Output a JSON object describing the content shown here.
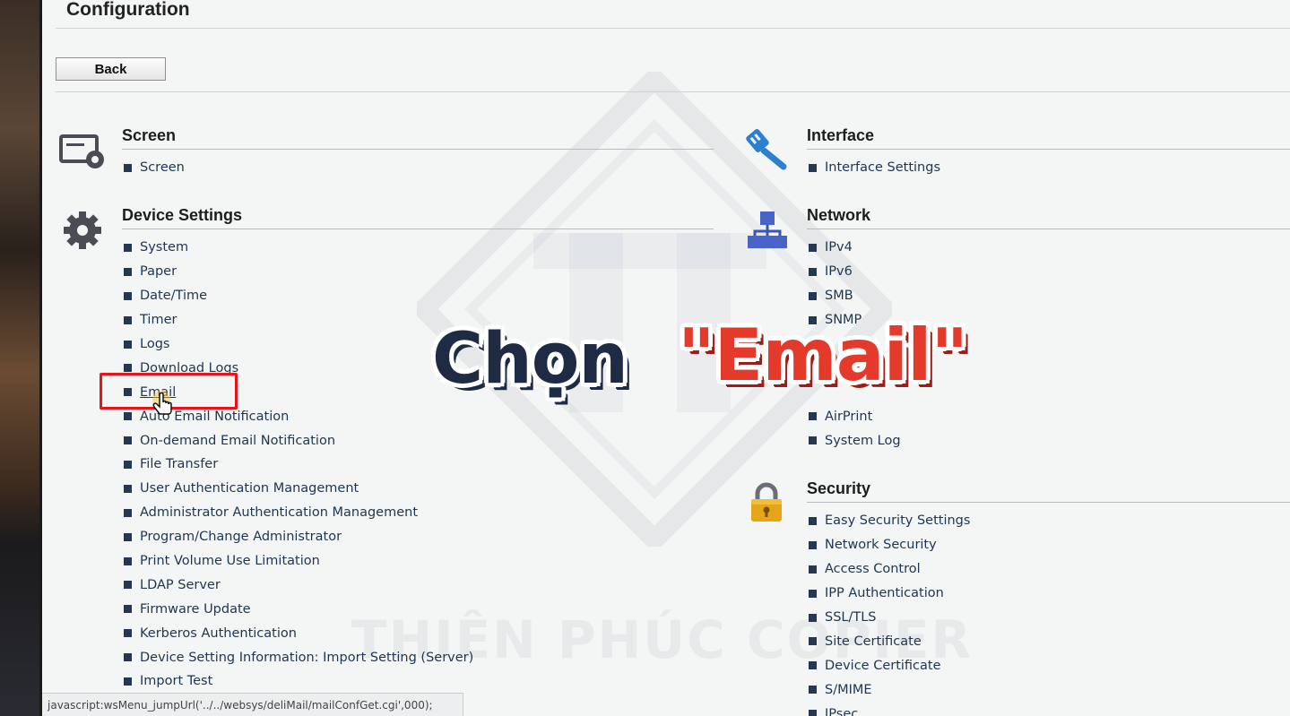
{
  "page": {
    "title": "Configuration",
    "back_label": "Back"
  },
  "sections": {
    "screen": {
      "title": "Screen",
      "items": [
        "Screen"
      ]
    },
    "device": {
      "title": "Device Settings",
      "items": [
        "System",
        "Paper",
        "Date/Time",
        "Timer",
        "Logs",
        "Download Logs",
        "Email",
        "Auto Email Notification",
        "On-demand Email Notification",
        "File Transfer",
        "User Authentication Management",
        "Administrator Authentication Management",
        "Program/Change Administrator",
        "Print Volume Use Limitation",
        "LDAP Server",
        "Firmware Update",
        "Kerberos Authentication",
        "Device Setting Information: Import Setting (Server)",
        "Import Test"
      ]
    },
    "interface": {
      "title": "Interface",
      "items": [
        "Interface Settings"
      ]
    },
    "network": {
      "title": "Network",
      "items": [
        "IPv4",
        "IPv6",
        "SMB",
        "SNMP",
        "",
        "",
        "",
        "AirPrint",
        "System Log"
      ]
    },
    "security": {
      "title": "Security",
      "items": [
        "Easy Security Settings",
        "Network Security",
        "Access Control",
        "IPP Authentication",
        "SSL/TLS",
        "Site Certificate",
        "Device Certificate",
        "S/MIME",
        "IPsec"
      ]
    }
  },
  "overlay": {
    "word1": "Chọn",
    "word2": "\"Email\"",
    "watermark": "THIÊN PHÚC COPIER"
  },
  "status_bar": {
    "text": "javascript:wsMenu_jumpUrl('../../websys/deliMail/mailConfGet.cgi',000);"
  },
  "colors": {
    "link": "#1f3550",
    "highlight": "#e8141c",
    "overlay_red": "#e43a2c",
    "overlay_navy": "#1f2a44"
  }
}
